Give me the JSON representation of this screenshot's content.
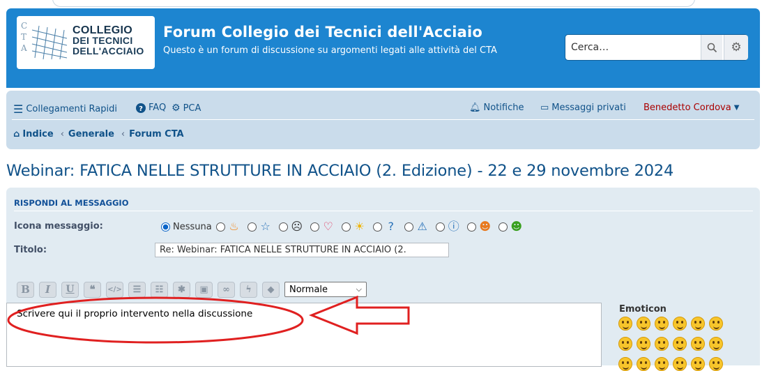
{
  "header": {
    "logo_alt": "CTA Collegio dei Tecnici dell'Acciaio",
    "logo_letters": [
      "C",
      "T",
      "A"
    ],
    "logo_words": [
      "COLLEGIO",
      "DEI TECNICI",
      "DELL'ACCIAIO"
    ],
    "title": "Forum Collegio dei Tecnici dell'Acciaio",
    "description": "Questo è un forum di discussione su argomenti legati alle attività del CTA",
    "search_placeholder": "Cerca…"
  },
  "navbar": {
    "quick_links": "Collegamenti Rapidi",
    "faq": "FAQ",
    "ucp": "PCA",
    "notifications": "Notifiche",
    "private_messages": "Messaggi privati",
    "username": "Benedetto Cordova"
  },
  "breadcrumbs": [
    "Indice",
    "Generale",
    "Forum CTA"
  ],
  "topic_title": "Webinar: FATICA NELLE STRUTTURE IN ACCIAIO (2. Edizione) - 22 e 29 novembre 2024",
  "reply": {
    "section_title": "RISPONDI AL MESSAGGIO",
    "icon_label": "Icona messaggio:",
    "icon_none": "Nessuna",
    "post_icons": [
      "fire-icon",
      "star-icon",
      "skull-icon",
      "heart-icon",
      "sun-icon",
      "question-icon",
      "warning-icon",
      "info-icon",
      "face-icon",
      "grin-icon"
    ],
    "subject_label": "Titolo:",
    "subject_value": "Re: Webinar: FATICA NELLE STRUTTURE IN ACCIAIO (2.",
    "toolbar": [
      "B",
      "I",
      "U",
      "quote",
      "code",
      "list",
      "list-numbered",
      "asterisk",
      "image",
      "link",
      "flash",
      "color"
    ],
    "font_size_selected": "Normale",
    "editor_text": "Scrivere qui il proprio intervento nella discussione",
    "emoticon_title": "Emoticon"
  },
  "colors": {
    "header_bg": "#1d85d0",
    "navbar_bg": "#cadceb",
    "link": "#105289",
    "panel_bg": "#e1ebf2",
    "annotation": "#e02020"
  }
}
